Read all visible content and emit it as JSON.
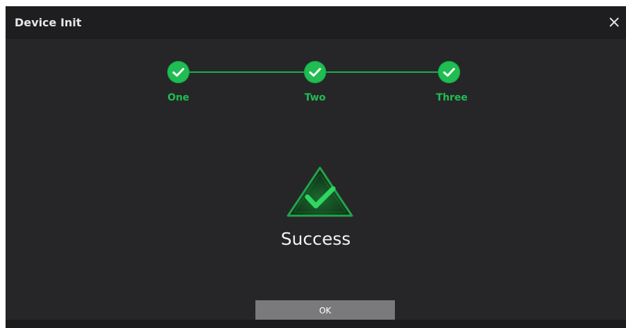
{
  "dialog": {
    "title": "Device Init",
    "close_icon": "close-icon"
  },
  "steps": [
    {
      "label": "One",
      "status": "completed",
      "icon": "check-icon"
    },
    {
      "label": "Two",
      "status": "completed",
      "icon": "check-icon"
    },
    {
      "label": "Three",
      "status": "completed",
      "icon": "check-icon"
    }
  ],
  "result": {
    "icon": "success-triangle-check-icon",
    "message": "Success"
  },
  "actions": {
    "ok_label": "OK"
  },
  "colors": {
    "accent_green": "#1fbd52",
    "background": "#262628",
    "titlebar": "#1e1e20",
    "button": "#7a7a7c"
  }
}
